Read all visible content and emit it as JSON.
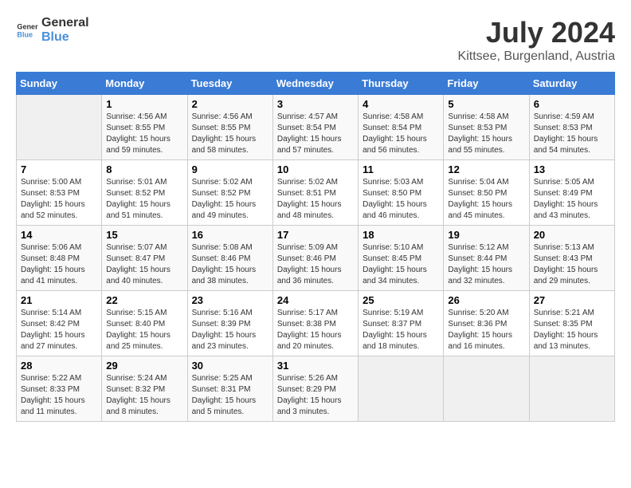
{
  "header": {
    "logo_line1": "General",
    "logo_line2": "Blue",
    "month_year": "July 2024",
    "location": "Kittsee, Burgenland, Austria"
  },
  "calendar": {
    "days_of_week": [
      "Sunday",
      "Monday",
      "Tuesday",
      "Wednesday",
      "Thursday",
      "Friday",
      "Saturday"
    ],
    "weeks": [
      [
        {
          "day": "",
          "info": ""
        },
        {
          "day": "1",
          "info": "Sunrise: 4:56 AM\nSunset: 8:55 PM\nDaylight: 15 hours\nand 59 minutes."
        },
        {
          "day": "2",
          "info": "Sunrise: 4:56 AM\nSunset: 8:55 PM\nDaylight: 15 hours\nand 58 minutes."
        },
        {
          "day": "3",
          "info": "Sunrise: 4:57 AM\nSunset: 8:54 PM\nDaylight: 15 hours\nand 57 minutes."
        },
        {
          "day": "4",
          "info": "Sunrise: 4:58 AM\nSunset: 8:54 PM\nDaylight: 15 hours\nand 56 minutes."
        },
        {
          "day": "5",
          "info": "Sunrise: 4:58 AM\nSunset: 8:53 PM\nDaylight: 15 hours\nand 55 minutes."
        },
        {
          "day": "6",
          "info": "Sunrise: 4:59 AM\nSunset: 8:53 PM\nDaylight: 15 hours\nand 54 minutes."
        }
      ],
      [
        {
          "day": "7",
          "info": "Sunrise: 5:00 AM\nSunset: 8:53 PM\nDaylight: 15 hours\nand 52 minutes."
        },
        {
          "day": "8",
          "info": "Sunrise: 5:01 AM\nSunset: 8:52 PM\nDaylight: 15 hours\nand 51 minutes."
        },
        {
          "day": "9",
          "info": "Sunrise: 5:02 AM\nSunset: 8:52 PM\nDaylight: 15 hours\nand 49 minutes."
        },
        {
          "day": "10",
          "info": "Sunrise: 5:02 AM\nSunset: 8:51 PM\nDaylight: 15 hours\nand 48 minutes."
        },
        {
          "day": "11",
          "info": "Sunrise: 5:03 AM\nSunset: 8:50 PM\nDaylight: 15 hours\nand 46 minutes."
        },
        {
          "day": "12",
          "info": "Sunrise: 5:04 AM\nSunset: 8:50 PM\nDaylight: 15 hours\nand 45 minutes."
        },
        {
          "day": "13",
          "info": "Sunrise: 5:05 AM\nSunset: 8:49 PM\nDaylight: 15 hours\nand 43 minutes."
        }
      ],
      [
        {
          "day": "14",
          "info": "Sunrise: 5:06 AM\nSunset: 8:48 PM\nDaylight: 15 hours\nand 41 minutes."
        },
        {
          "day": "15",
          "info": "Sunrise: 5:07 AM\nSunset: 8:47 PM\nDaylight: 15 hours\nand 40 minutes."
        },
        {
          "day": "16",
          "info": "Sunrise: 5:08 AM\nSunset: 8:46 PM\nDaylight: 15 hours\nand 38 minutes."
        },
        {
          "day": "17",
          "info": "Sunrise: 5:09 AM\nSunset: 8:46 PM\nDaylight: 15 hours\nand 36 minutes."
        },
        {
          "day": "18",
          "info": "Sunrise: 5:10 AM\nSunset: 8:45 PM\nDaylight: 15 hours\nand 34 minutes."
        },
        {
          "day": "19",
          "info": "Sunrise: 5:12 AM\nSunset: 8:44 PM\nDaylight: 15 hours\nand 32 minutes."
        },
        {
          "day": "20",
          "info": "Sunrise: 5:13 AM\nSunset: 8:43 PM\nDaylight: 15 hours\nand 29 minutes."
        }
      ],
      [
        {
          "day": "21",
          "info": "Sunrise: 5:14 AM\nSunset: 8:42 PM\nDaylight: 15 hours\nand 27 minutes."
        },
        {
          "day": "22",
          "info": "Sunrise: 5:15 AM\nSunset: 8:40 PM\nDaylight: 15 hours\nand 25 minutes."
        },
        {
          "day": "23",
          "info": "Sunrise: 5:16 AM\nSunset: 8:39 PM\nDaylight: 15 hours\nand 23 minutes."
        },
        {
          "day": "24",
          "info": "Sunrise: 5:17 AM\nSunset: 8:38 PM\nDaylight: 15 hours\nand 20 minutes."
        },
        {
          "day": "25",
          "info": "Sunrise: 5:19 AM\nSunset: 8:37 PM\nDaylight: 15 hours\nand 18 minutes."
        },
        {
          "day": "26",
          "info": "Sunrise: 5:20 AM\nSunset: 8:36 PM\nDaylight: 15 hours\nand 16 minutes."
        },
        {
          "day": "27",
          "info": "Sunrise: 5:21 AM\nSunset: 8:35 PM\nDaylight: 15 hours\nand 13 minutes."
        }
      ],
      [
        {
          "day": "28",
          "info": "Sunrise: 5:22 AM\nSunset: 8:33 PM\nDaylight: 15 hours\nand 11 minutes."
        },
        {
          "day": "29",
          "info": "Sunrise: 5:24 AM\nSunset: 8:32 PM\nDaylight: 15 hours\nand 8 minutes."
        },
        {
          "day": "30",
          "info": "Sunrise: 5:25 AM\nSunset: 8:31 PM\nDaylight: 15 hours\nand 5 minutes."
        },
        {
          "day": "31",
          "info": "Sunrise: 5:26 AM\nSunset: 8:29 PM\nDaylight: 15 hours\nand 3 minutes."
        },
        {
          "day": "",
          "info": ""
        },
        {
          "day": "",
          "info": ""
        },
        {
          "day": "",
          "info": ""
        }
      ]
    ]
  }
}
